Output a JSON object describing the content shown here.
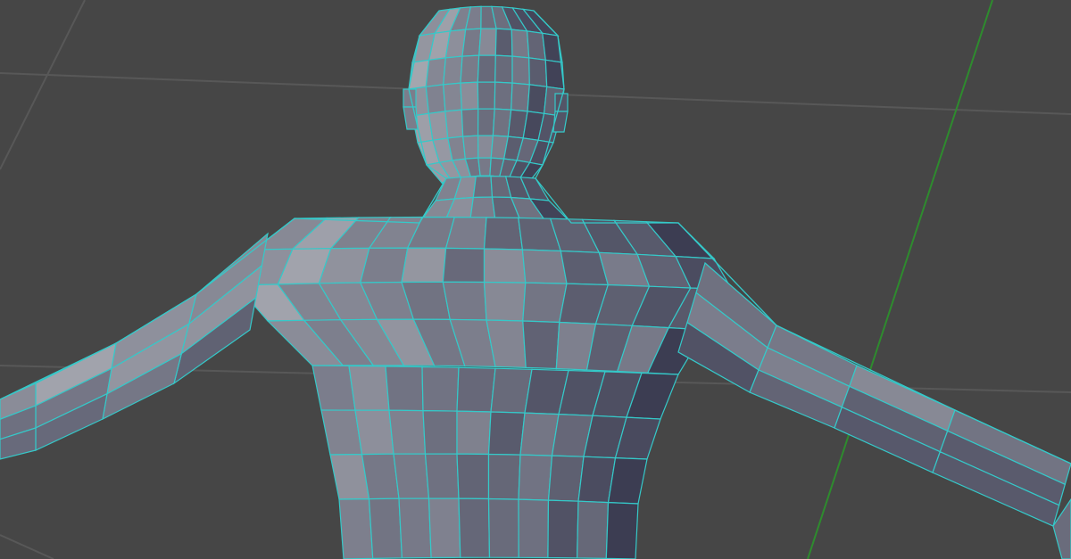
{
  "viewport": {
    "background": "#464646",
    "grid_color": "#585858",
    "axis_color": "#2e8b2e"
  },
  "mesh": {
    "object": "human-base-mesh",
    "display_mode": "wireframe-on-shaded",
    "wire_color": "#35c9c9",
    "shade_light": "#a7a9b1",
    "shade_mid": "#767887",
    "shade_dark": "#3c3d52",
    "selected": true
  }
}
